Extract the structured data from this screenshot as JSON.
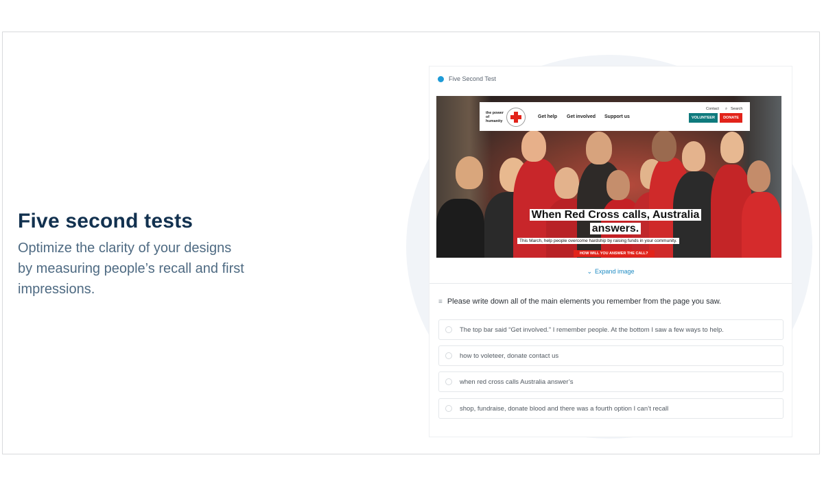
{
  "headline": "Five second tests",
  "subcopy_lines": [
    "Optimize the clarity of your designs",
    "by measuring people’s recall and first",
    "impressions."
  ],
  "card": {
    "label": "Five Second Test",
    "expand_label": "Expand image",
    "question": "Please write down all of the main elements you remember from the page you saw.",
    "answers": [
      "The top bar said “Get involved.” I remember people. At the bottom I saw a few ways to help.",
      "how to voleteer, donate contact us",
      "when red cross calls Australia answer’s",
      "shop, fundraise, donate blood and there was a fourth option I can’t recall"
    ]
  },
  "hero": {
    "brand": "the power of humanity",
    "nav": [
      "Get help",
      "Get involved",
      "Support us"
    ],
    "contact": "Contact",
    "search": "Search",
    "volunteer": "VOLUNTEER",
    "donate": "DONATE",
    "title_line1": "When Red Cross calls, Australia",
    "title_line2": "answers.",
    "subtitle": "This March, help people overcome hardship by raising funds in your community.",
    "cta": "HOW WILL YOU ANSWER THE CALL?"
  },
  "colors": {
    "headline": "#12314f",
    "subcopy": "#4e6a82",
    "accent_blue": "#1e9bd7",
    "red_cross": "#e2231a",
    "teal": "#0f7a7d"
  }
}
